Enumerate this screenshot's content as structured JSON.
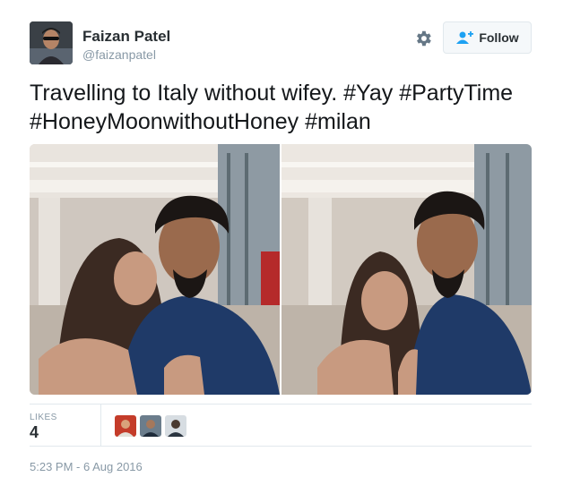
{
  "author": {
    "name": "Faizan Patel",
    "handle": "@faizanpatel",
    "avatar_icon": "user-avatar"
  },
  "actions": {
    "settings_icon": "gear-icon",
    "follow_label": "Follow",
    "follow_icon": "add-user-icon"
  },
  "tweet": {
    "text": "Travelling to Italy without wifey. #Yay #PartyTime #HoneyMoonwithoutHoney #milan"
  },
  "media": {
    "photos": [
      "selfie-photo-1",
      "selfie-photo-2"
    ]
  },
  "stats": {
    "likes_label": "LIKES",
    "likes_count": "4",
    "likers": [
      "liker-avatar-1",
      "liker-avatar-2",
      "liker-avatar-3"
    ]
  },
  "timestamp": "5:23 PM - 6 Aug 2016",
  "colors": {
    "text": "#292f33",
    "muted": "#8899a6",
    "border": "#e1e8ed",
    "accent": "#1da1f2"
  }
}
